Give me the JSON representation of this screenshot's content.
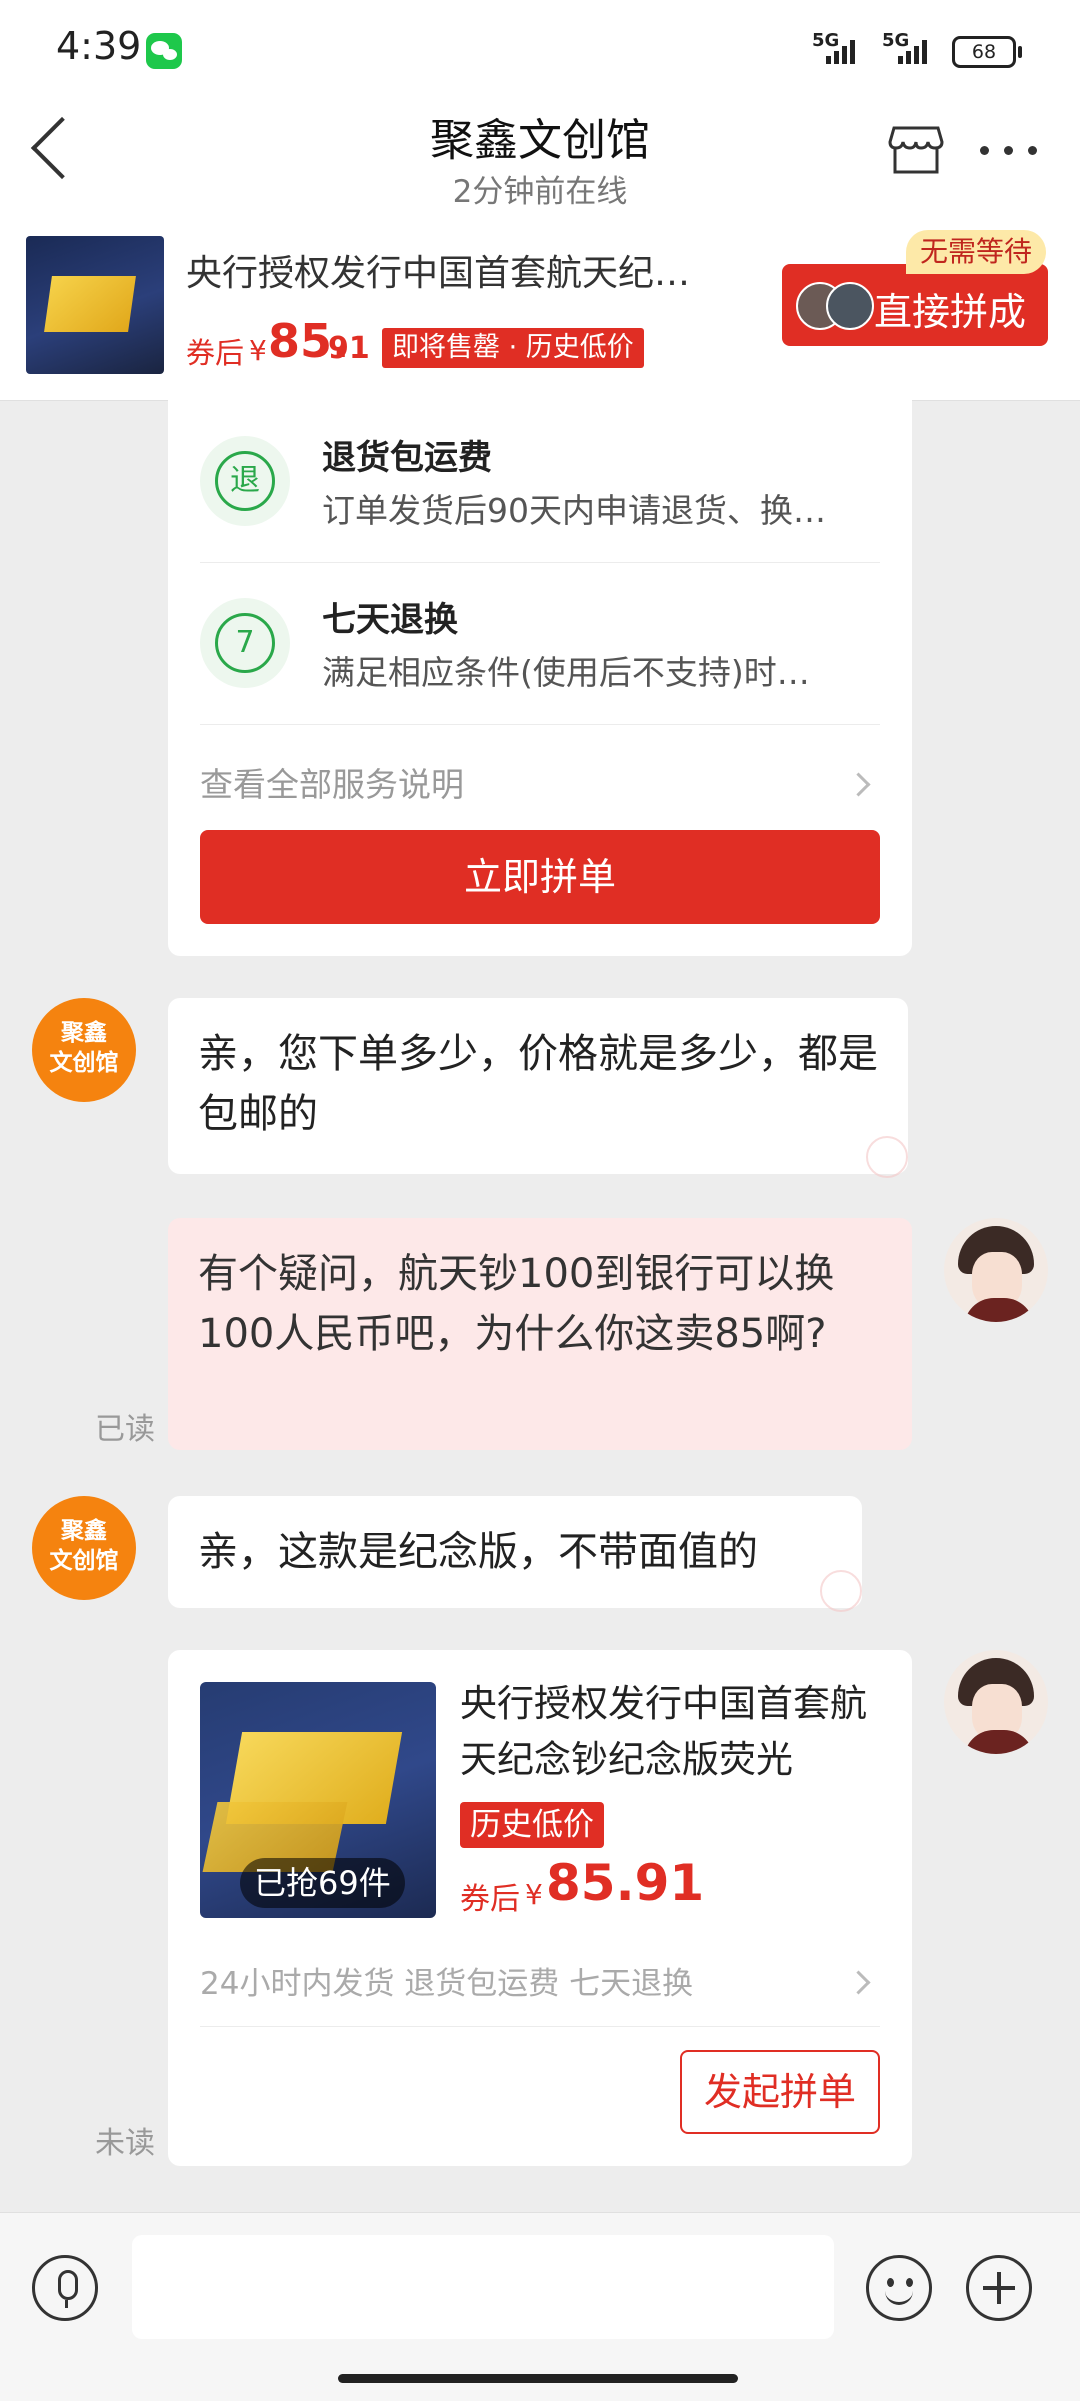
{
  "status_bar": {
    "time": "4:39",
    "network1": "5G",
    "network2": "5G",
    "battery": "68"
  },
  "nav": {
    "title": "聚鑫文创馆",
    "subtitle": "2分钟前在线"
  },
  "banner": {
    "title": "央行授权发行中国首套航天纪…",
    "coupon_prefix": "券后",
    "currency": "¥",
    "price_int": "85.",
    "price_dec": "91",
    "sale_tag": "即将售罄 · 历史低价",
    "group_button": "直接拼成",
    "no_wait": "无需等待"
  },
  "service_card": {
    "items": [
      {
        "icon_char": "退",
        "title": "退货包运费",
        "desc": "订单发货后90天内申请退货、换…"
      },
      {
        "icon_char": "7",
        "title": "七天退换",
        "desc": "满足相应条件(使用后不支持)时…"
      }
    ],
    "view_all": "查看全部服务说明",
    "order_button": "立即拼单"
  },
  "chat": {
    "shop_avatar_line1": "聚鑫",
    "shop_avatar_line2": "文创馆",
    "msg1": "亲，您下单多少，价格就是多少，都是包邮的",
    "msg2": "有个疑问，航天钞100到银行可以换100人民币吧，为什么你这卖85啊?",
    "msg2_status": "已读",
    "msg3": "亲，这款是纪念版，不带面值的",
    "card_status": "未读"
  },
  "product_card": {
    "sold": "已抢69件",
    "title": "央行授权发行中国首套航天纪念钞纪念版荧光",
    "low_tag": "历史低价",
    "coupon_prefix": "券后",
    "currency": "¥",
    "price": "85.91",
    "services": "24小时内发货 退货包运费 七天退换",
    "launch_button": "发起拼单"
  },
  "input": {
    "placeholder": ""
  },
  "colors": {
    "accent": "#e02e24",
    "shop_avatar": "#f5830f",
    "service_green": "#2aa84a"
  }
}
